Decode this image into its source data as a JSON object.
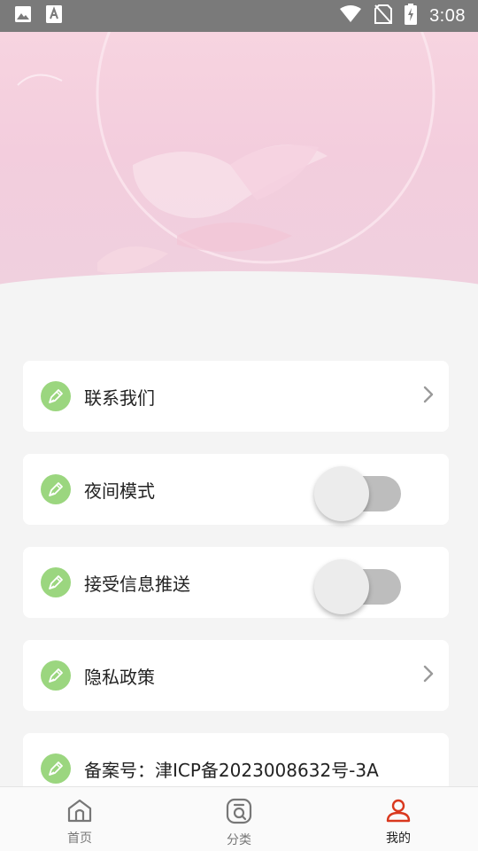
{
  "status_bar": {
    "time": "3:08",
    "left_icons": [
      "image-icon",
      "font-icon"
    ],
    "right_icons": [
      "wifi-icon",
      "no-sim-icon",
      "battery-charging-icon"
    ]
  },
  "settings": [
    {
      "label": "联系我们",
      "control": "chevron"
    },
    {
      "label": "夜间模式",
      "control": "toggle",
      "state": "off"
    },
    {
      "label": "接受信息推送",
      "control": "toggle",
      "state": "off"
    },
    {
      "label": "隐私政策",
      "control": "chevron"
    },
    {
      "label": "备案号：津ICP备2023008632号-3A",
      "control": "none"
    }
  ],
  "bottom_nav": [
    {
      "label": "首页",
      "icon": "home-icon"
    },
    {
      "label": "分类",
      "icon": "category-search-icon"
    },
    {
      "label": "我的",
      "icon": "user-icon",
      "active": true
    }
  ],
  "colors": {
    "accent": "#d9381e",
    "item_icon_bg": "#9bd67f",
    "banner": "#f3cddd",
    "page_bg": "#f4f4f4"
  }
}
